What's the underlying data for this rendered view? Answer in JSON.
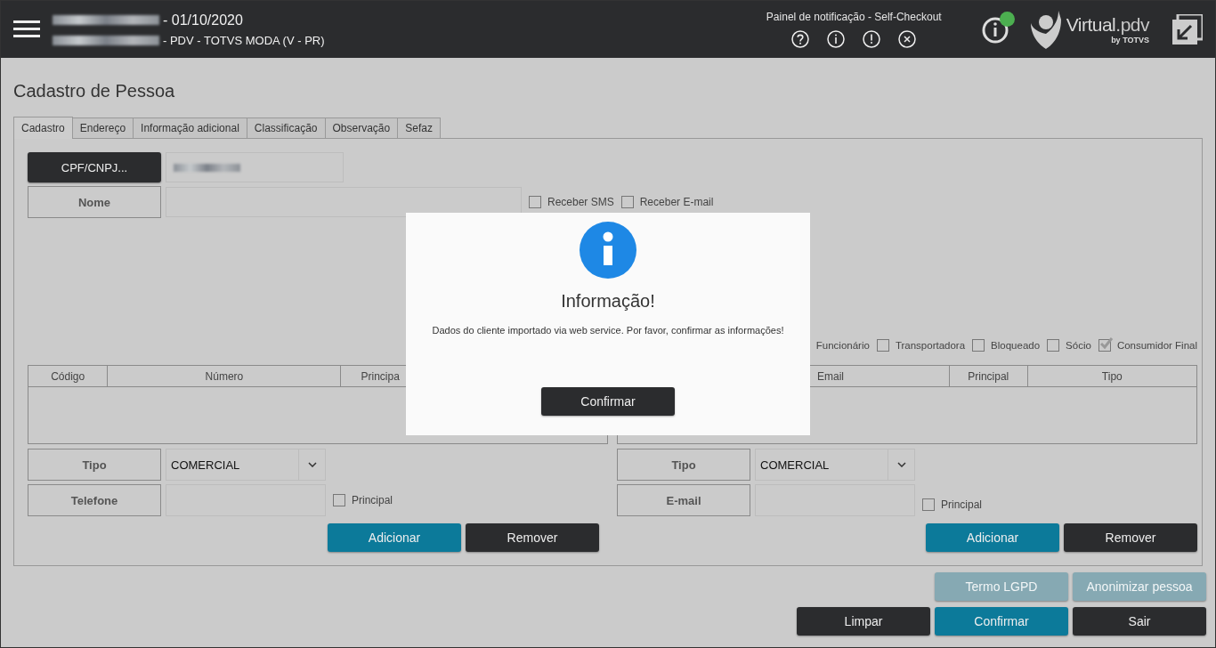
{
  "header": {
    "date_line": "- 01/10/2020",
    "store_line": "- PDV - TOTVS MODA (V - PR)",
    "notification_panel": {
      "title": "Painel de notificação - Self-Checkout"
    },
    "status_indicator": {
      "on": true
    },
    "logo": {
      "name": "Virtual",
      "suffix": ".pdv",
      "byline": "by",
      "company": "TOTVS"
    }
  },
  "page_title": "Cadastro de Pessoa",
  "tabs": [
    {
      "label": "Cadastro",
      "selected": true
    },
    {
      "label": "Endereço",
      "selected": false
    },
    {
      "label": "Informação adicional",
      "selected": false
    },
    {
      "label": "Classificação",
      "selected": false
    },
    {
      "label": "Observação",
      "selected": false
    },
    {
      "label": "Sefaz",
      "selected": false
    }
  ],
  "form": {
    "cpf_button": "CPF/CNPJ...",
    "name_label": "Nome",
    "options": [
      {
        "label": "Receber SMS",
        "checked": false
      },
      {
        "label": "Receber E-mail",
        "checked": false
      }
    ],
    "flags": [
      {
        "label": "Funcionário"
      },
      {
        "label": "Transportadora",
        "checked": false
      },
      {
        "label": "Bloqueado",
        "checked": false
      },
      {
        "label": "Sócio",
        "checked": false
      },
      {
        "label": "Consumidor Final",
        "checked": true
      }
    ]
  },
  "contacts": [
    {
      "columns": [
        "Código",
        "Número",
        "Principa"
      ],
      "type_label": "Tipo",
      "type_value": "COMERCIAL",
      "field_label": "Telefone",
      "principal": {
        "label": "Principal",
        "checked": false
      },
      "buttons": [
        "Adicionar",
        "Remover"
      ]
    },
    {
      "columns": [
        "Email",
        "Principal",
        "Tipo"
      ],
      "type_label": "Tipo",
      "type_value": "COMERCIAL",
      "field_label": "E-mail",
      "principal": {
        "label": "Principal",
        "checked": false
      },
      "buttons": [
        "Adicionar",
        "Remover"
      ]
    }
  ],
  "secondary_buttons": [
    {
      "label": "Termo LGPD",
      "disabled": true
    },
    {
      "label": "Anonimizar pessoa",
      "disabled": true
    }
  ],
  "footer_buttons": [
    {
      "label": "Limpar",
      "kind": "dark"
    },
    {
      "label": "Confirmar",
      "kind": "primary"
    },
    {
      "label": "Sair",
      "kind": "dark"
    }
  ],
  "dialog": {
    "title": "Informação!",
    "message": "Dados do cliente importado via web service. Por favor, confirmar as informações!",
    "button": "Confirmar"
  }
}
